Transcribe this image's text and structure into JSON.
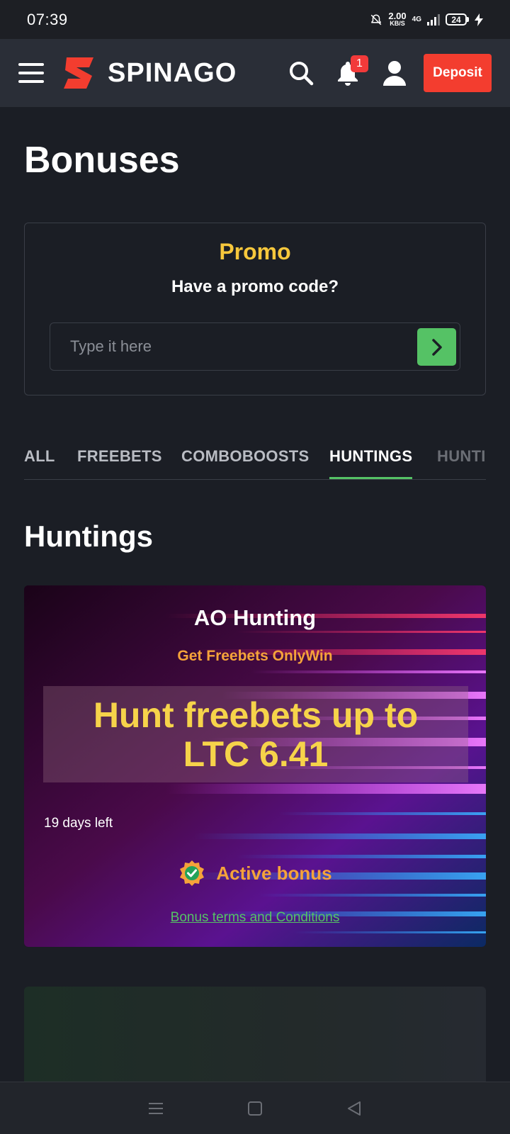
{
  "status_bar": {
    "time": "07:39",
    "speed_value": "2.00",
    "speed_unit": "KB/S",
    "network": "4G",
    "battery": "24"
  },
  "header": {
    "brand": "SPINAGO",
    "notification_count": "1",
    "deposit_label": "Deposit",
    "icons": [
      "menu-icon",
      "logo-mark",
      "search-icon",
      "bell-icon",
      "user-icon"
    ]
  },
  "page": {
    "title": "Bonuses"
  },
  "promo": {
    "title": "Promo",
    "subtitle": "Have a promo code?",
    "placeholder": "Type it here",
    "value": ""
  },
  "tabs": [
    {
      "label": "ALL",
      "active": false
    },
    {
      "label": "FREEBETS",
      "active": false
    },
    {
      "label": "COMBOBOOSTS",
      "active": false
    },
    {
      "label": "HUNTINGS",
      "active": true
    },
    {
      "label": "HUNTI",
      "active": false
    }
  ],
  "section": {
    "title": "Huntings"
  },
  "hunting_card": {
    "name": "AO Hunting",
    "subtitle": "Get Freebets OnlyWin",
    "headline_line1": "Hunt freebets up to",
    "headline_line2": "LTC 6.41",
    "days_left": "19 days left",
    "status": "Active bonus",
    "terms_link": "Bonus terms and Conditions"
  },
  "colors": {
    "accent_green": "#55c265",
    "brand_red": "#f33d2f",
    "promo_yellow": "#f6c73c",
    "orange": "#f5a33a"
  }
}
